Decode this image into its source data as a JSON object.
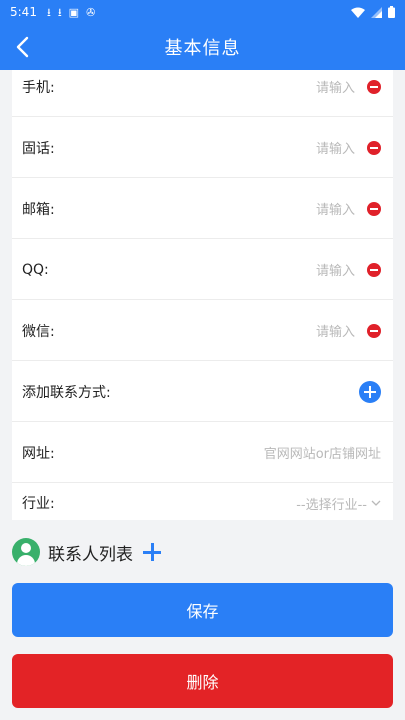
{
  "status_bar": {
    "time": "5:41",
    "left_icons": [
      "download-icon",
      "download-icon",
      "sim-icon",
      "battery-saver-icon"
    ],
    "right_icons": [
      "wifi-icon",
      "signal-icon",
      "battery-icon"
    ]
  },
  "app_bar": {
    "title": "基本信息",
    "back_icon": "chevron-left-icon"
  },
  "form": {
    "rows": [
      {
        "label": "手机:",
        "value": "请输入",
        "action": "remove"
      },
      {
        "label": "固话:",
        "value": "请输入",
        "action": "remove"
      },
      {
        "label": "邮箱:",
        "value": "请输入",
        "action": "remove"
      },
      {
        "label": "QQ:",
        "value": "请输入",
        "action": "remove"
      },
      {
        "label": "微信:",
        "value": "请输入",
        "action": "remove"
      },
      {
        "label": "添加联系方式:",
        "value": "",
        "action": "add"
      },
      {
        "label": "网址:",
        "value": "官网网站or店铺网址",
        "action": "none"
      },
      {
        "label": "行业:",
        "value": "--选择行业--",
        "action": "dropdown"
      }
    ]
  },
  "contacts": {
    "label": "联系人列表"
  },
  "buttons": {
    "save": "保存",
    "delete": "删除"
  },
  "colors": {
    "primary": "#2a7ff6",
    "danger": "#e32326",
    "remove_icon": "#e0212a",
    "avatar": "#39b06b",
    "placeholder": "#b9b9b9"
  }
}
